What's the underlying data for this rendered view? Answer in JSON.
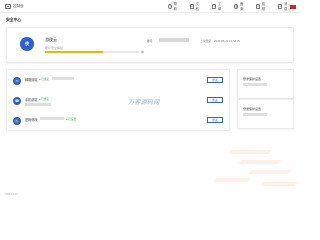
{
  "app": {
    "logo_text": "控制台"
  },
  "topnav": [
    {
      "label": "帮助",
      "icon": "help-icon",
      "glyph": "?"
    },
    {
      "label": "文档",
      "icon": "document-icon",
      "glyph": "≡"
    },
    {
      "label": "工单",
      "icon": "ticket-icon",
      "glyph": "✎"
    },
    {
      "label": "备案",
      "icon": "record-icon",
      "glyph": "◍"
    },
    {
      "label": "费用",
      "icon": "billing-icon",
      "glyph": "¥"
    },
    {
      "label": "消息",
      "icon": "bell-icon",
      "glyph": "✉"
    }
  ],
  "page": {
    "title": "安全中心"
  },
  "profile": {
    "avatar_initial": "侠",
    "username": "游侠云",
    "level_text": "账户安全等级",
    "level_value": "中",
    "progress": 0.62,
    "account_label": "账号",
    "last_login_label": "上次登录",
    "last_login_time": "2020-05-22 14:58:35"
  },
  "security_items": [
    {
      "icon": "mail-icon",
      "glyph": "✉",
      "title": "邮箱绑定",
      "status": "● 已绑定",
      "action": "修改"
    },
    {
      "icon": "phone-icon",
      "glyph": "☎",
      "title": "手机绑定",
      "status": "● 已绑定",
      "action": "修改"
    },
    {
      "icon": "lock-icon",
      "glyph": "🔒",
      "title": "密码修改",
      "status": "● 已设置",
      "action": "修改"
    }
  ],
  "side_cards": [
    {
      "title": "登录保护设置"
    },
    {
      "title": "登录保护设置"
    }
  ],
  "watermark": "刀客源码网",
  "footer": "V:888.1.0.00",
  "colors": {
    "accent": "#2c61cf",
    "progress": "#f4b400",
    "success": "#2ea043",
    "flag": "#d8232a"
  }
}
